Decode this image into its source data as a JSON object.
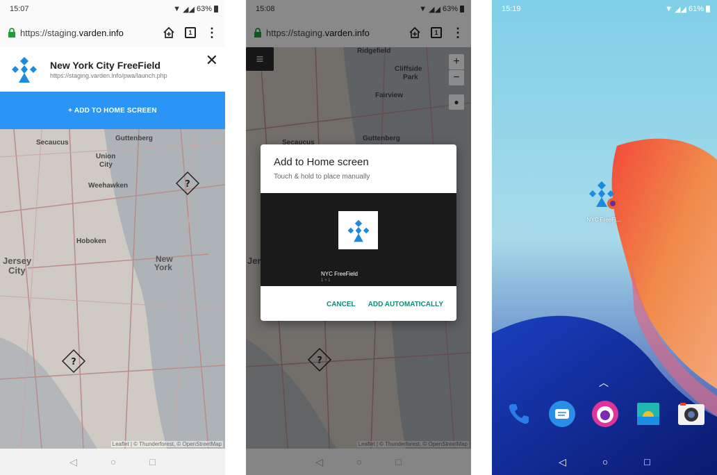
{
  "phone1": {
    "status": {
      "time": "15:07",
      "battery": "63%"
    },
    "urlbar": {
      "prefix": "https://staging.",
      "domain": "varden.info"
    },
    "tab_count": "1",
    "install": {
      "title": "New York City FreeField",
      "url": "https://staging.varden.info/pwa/launch.php"
    },
    "add_button": "+ ADD TO HOME SCREEN",
    "map_labels": [
      "Secaucus",
      "Guttenberg",
      "Union",
      "City",
      "Weehawken",
      "Hoboken",
      "Jersey",
      "City",
      "New",
      "York"
    ],
    "attribution": "Leaflet | © Thunderforest, © OpenStreetMap"
  },
  "phone2": {
    "status": {
      "time": "15:08",
      "battery": "63%"
    },
    "urlbar": {
      "prefix": "https://staging.",
      "domain": "varden.info"
    },
    "tab_count": "1",
    "map_labels": [
      "Ridgefield",
      "Cliffside",
      "Park",
      "Fairview",
      "Guttenberg",
      "Secaucus",
      "Jers"
    ],
    "dialog": {
      "title": "Add to Home screen",
      "subtitle": "Touch & hold to place manually",
      "app_name": "NYC FreeField",
      "app_size": "1 × 1",
      "cancel": "CANCEL",
      "confirm": "ADD AUTOMATICALLY"
    },
    "attribution": "Leaflet | © Thunderforest, © OpenStreetMap"
  },
  "phone3": {
    "status": {
      "time": "15:19",
      "battery": "61%"
    },
    "app_label": "NYC FreeFi...",
    "dock_icons": [
      "phone-icon",
      "messages-icon",
      "firefox-icon",
      "gallery-icon",
      "camera-icon"
    ]
  },
  "colors": {
    "accent": "#2b95f5",
    "dialog_action": "#138a74",
    "brand_blue": "#1a8be0"
  }
}
